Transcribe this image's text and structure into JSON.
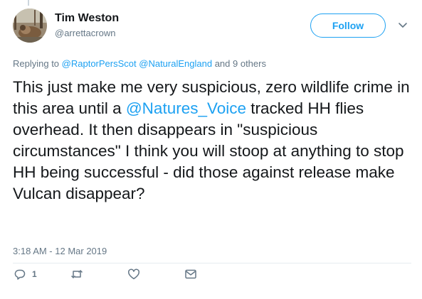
{
  "author": {
    "name": "Tim Weston",
    "handle": "@arrettacrown"
  },
  "follow_label": "Follow",
  "replying": {
    "prefix": "Replying to ",
    "mention1": "@RaptorPersScot",
    "mention2": "@NaturalEngland",
    "suffix": " and 9 others"
  },
  "tweet": {
    "part1": "This just make me very suspicious, zero wildlife crime in this area until a ",
    "mention": "@Natures_Voice",
    "part2": " tracked HH flies overhead. It then disappears in \"suspicious circumstances\" I think you will stoop at anything to stop HH being successful - did those against release make Vulcan disappear?"
  },
  "timestamp": "3:18 AM - 12 Mar 2019",
  "actions": {
    "reply_count": "1"
  },
  "icons": {
    "avatar": "profile-photo",
    "caret": "chevron-down-icon",
    "reply": "reply-icon",
    "retweet": "retweet-icon",
    "like": "heart-icon",
    "dm": "envelope-icon"
  },
  "colors": {
    "accent": "#1da1f2",
    "secondary_text": "#657786",
    "primary_text": "#14171a"
  }
}
